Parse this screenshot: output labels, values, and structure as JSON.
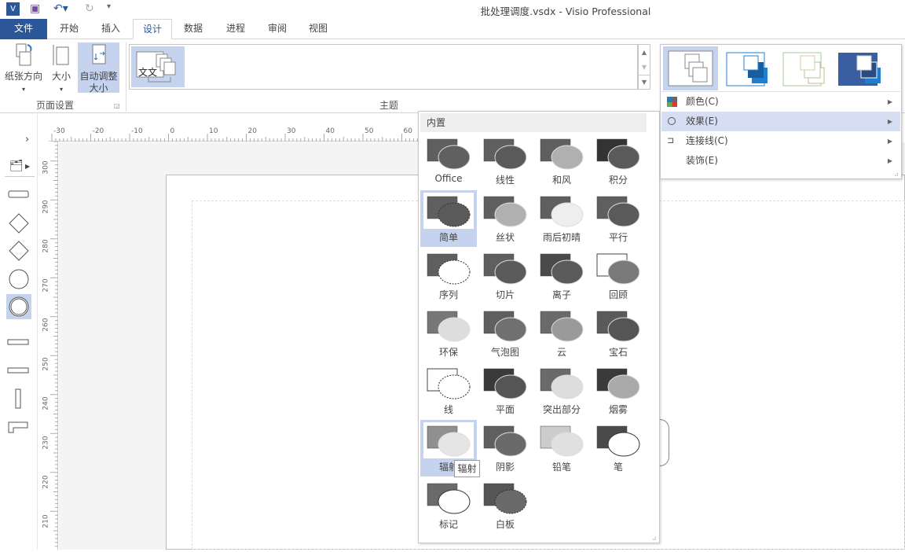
{
  "window": {
    "title": "批处理调度.vsdx - Visio Professional"
  },
  "quick_access": {
    "app_icon": "visio-icon",
    "save": "save-icon",
    "undo": "undo-icon",
    "redo": "redo-icon",
    "customize": "customize-icon"
  },
  "tabs": [
    {
      "label": "文件"
    },
    {
      "label": "开始"
    },
    {
      "label": "插入"
    },
    {
      "label": "设计",
      "active": true
    },
    {
      "label": "数据"
    },
    {
      "label": "进程"
    },
    {
      "label": "审阅"
    },
    {
      "label": "视图"
    }
  ],
  "ribbon": {
    "page_setup": {
      "group_label": "页面设置",
      "orientation": "纸张方向",
      "size": "大小",
      "autosize": "自动调整大小",
      "autosize_l1": "自动调整",
      "autosize_l2": "大小"
    },
    "themes": {
      "group_label": "主题",
      "thumb_text": "文文"
    }
  },
  "variants_menu": {
    "items": [
      {
        "label": "颜色(C)",
        "icon": "color-grid-icon"
      },
      {
        "label": "效果(E)",
        "icon": "circle-icon",
        "highlighted": true
      },
      {
        "label": "连接线(C)",
        "icon": "connector-icon"
      },
      {
        "label": "装饰(E)",
        "icon": ""
      }
    ],
    "colors": [
      "#888888",
      "#1e7fd0",
      "#a9c79e",
      "#3a5fa0"
    ]
  },
  "effects_gallery": {
    "header": "内置",
    "tooltip": "辐射",
    "items": [
      {
        "label": "Office",
        "rect": "#5f5f5f",
        "ell": "#606060"
      },
      {
        "label": "线性",
        "rect": "#5f5f5f",
        "ell": "#5a5a5a"
      },
      {
        "label": "和风",
        "rect": "#5f5f5f",
        "ell": "#b0b0b0"
      },
      {
        "label": "积分",
        "rect": "#333333",
        "ell": "#5a5a5a"
      },
      {
        "label": "简单",
        "rect": "#5f5f5f",
        "ell": "#5a5a5a",
        "selected": true,
        "dashed": true
      },
      {
        "label": "丝状",
        "rect": "#5f5f5f",
        "ell": "#b0b0b0"
      },
      {
        "label": "雨后初晴",
        "rect": "#5f5f5f",
        "ell": "#eeeeee"
      },
      {
        "label": "平行",
        "rect": "#5f5f5f",
        "ell": "#5a5a5a"
      },
      {
        "label": "序列",
        "rect": "#5f5f5f",
        "ell": "#ffffff",
        "dashed": true
      },
      {
        "label": "切片",
        "rect": "#5f5f5f",
        "ell": "#5a5a5a"
      },
      {
        "label": "离子",
        "rect": "#4a4a4a",
        "ell": "#5a5a5a"
      },
      {
        "label": "回顾",
        "rect": "#ffffff",
        "ell": "#7a7a7a"
      },
      {
        "label": "环保",
        "rect": "#777777",
        "ell": "#dddddd"
      },
      {
        "label": "气泡图",
        "rect": "#5f5f5f",
        "ell": "#707070"
      },
      {
        "label": "云",
        "rect": "#6a6a6a",
        "ell": "#9a9a9a"
      },
      {
        "label": "宝石",
        "rect": "#5a5a5a",
        "ell": "#555555"
      },
      {
        "label": "线",
        "rect": "#ffffff",
        "ell": "#ffffff",
        "dashed": true
      },
      {
        "label": "平面",
        "rect": "#3a3a3a",
        "ell": "#555555"
      },
      {
        "label": "突出部分",
        "rect": "#6a6a6a",
        "ell": "#dddddd"
      },
      {
        "label": "烟雾",
        "rect": "#3a3a3a",
        "ell": "#aaaaaa"
      },
      {
        "label": "辐射",
        "rect": "#909090",
        "ell": "#e5e5e5",
        "hovered": true
      },
      {
        "label": "阴影",
        "rect": "#5f5f5f",
        "ell": "#6a6a6a"
      },
      {
        "label": "铅笔",
        "rect": "#cccccc",
        "ell": "#e0e0e0"
      },
      {
        "label": "笔",
        "rect": "#4a4a4a",
        "ell": "#ffffff"
      },
      {
        "label": "标记",
        "rect": "#6a6a6a",
        "ell": "#ffffff"
      },
      {
        "label": "白板",
        "rect": "#555555",
        "ell": "#6a6a6a",
        "dashed": true
      }
    ]
  },
  "rulers": {
    "horizontal": [
      "-30",
      "-20",
      "-10",
      "0",
      "10",
      "20",
      "30",
      "40",
      "50",
      "60"
    ],
    "vertical": [
      "300",
      "290",
      "280",
      "270",
      "260",
      "250",
      "240",
      "230",
      "220",
      "210"
    ]
  },
  "shapes_panel": {
    "expand": "chevron-right-icon",
    "stencil": "stencil-icon"
  }
}
